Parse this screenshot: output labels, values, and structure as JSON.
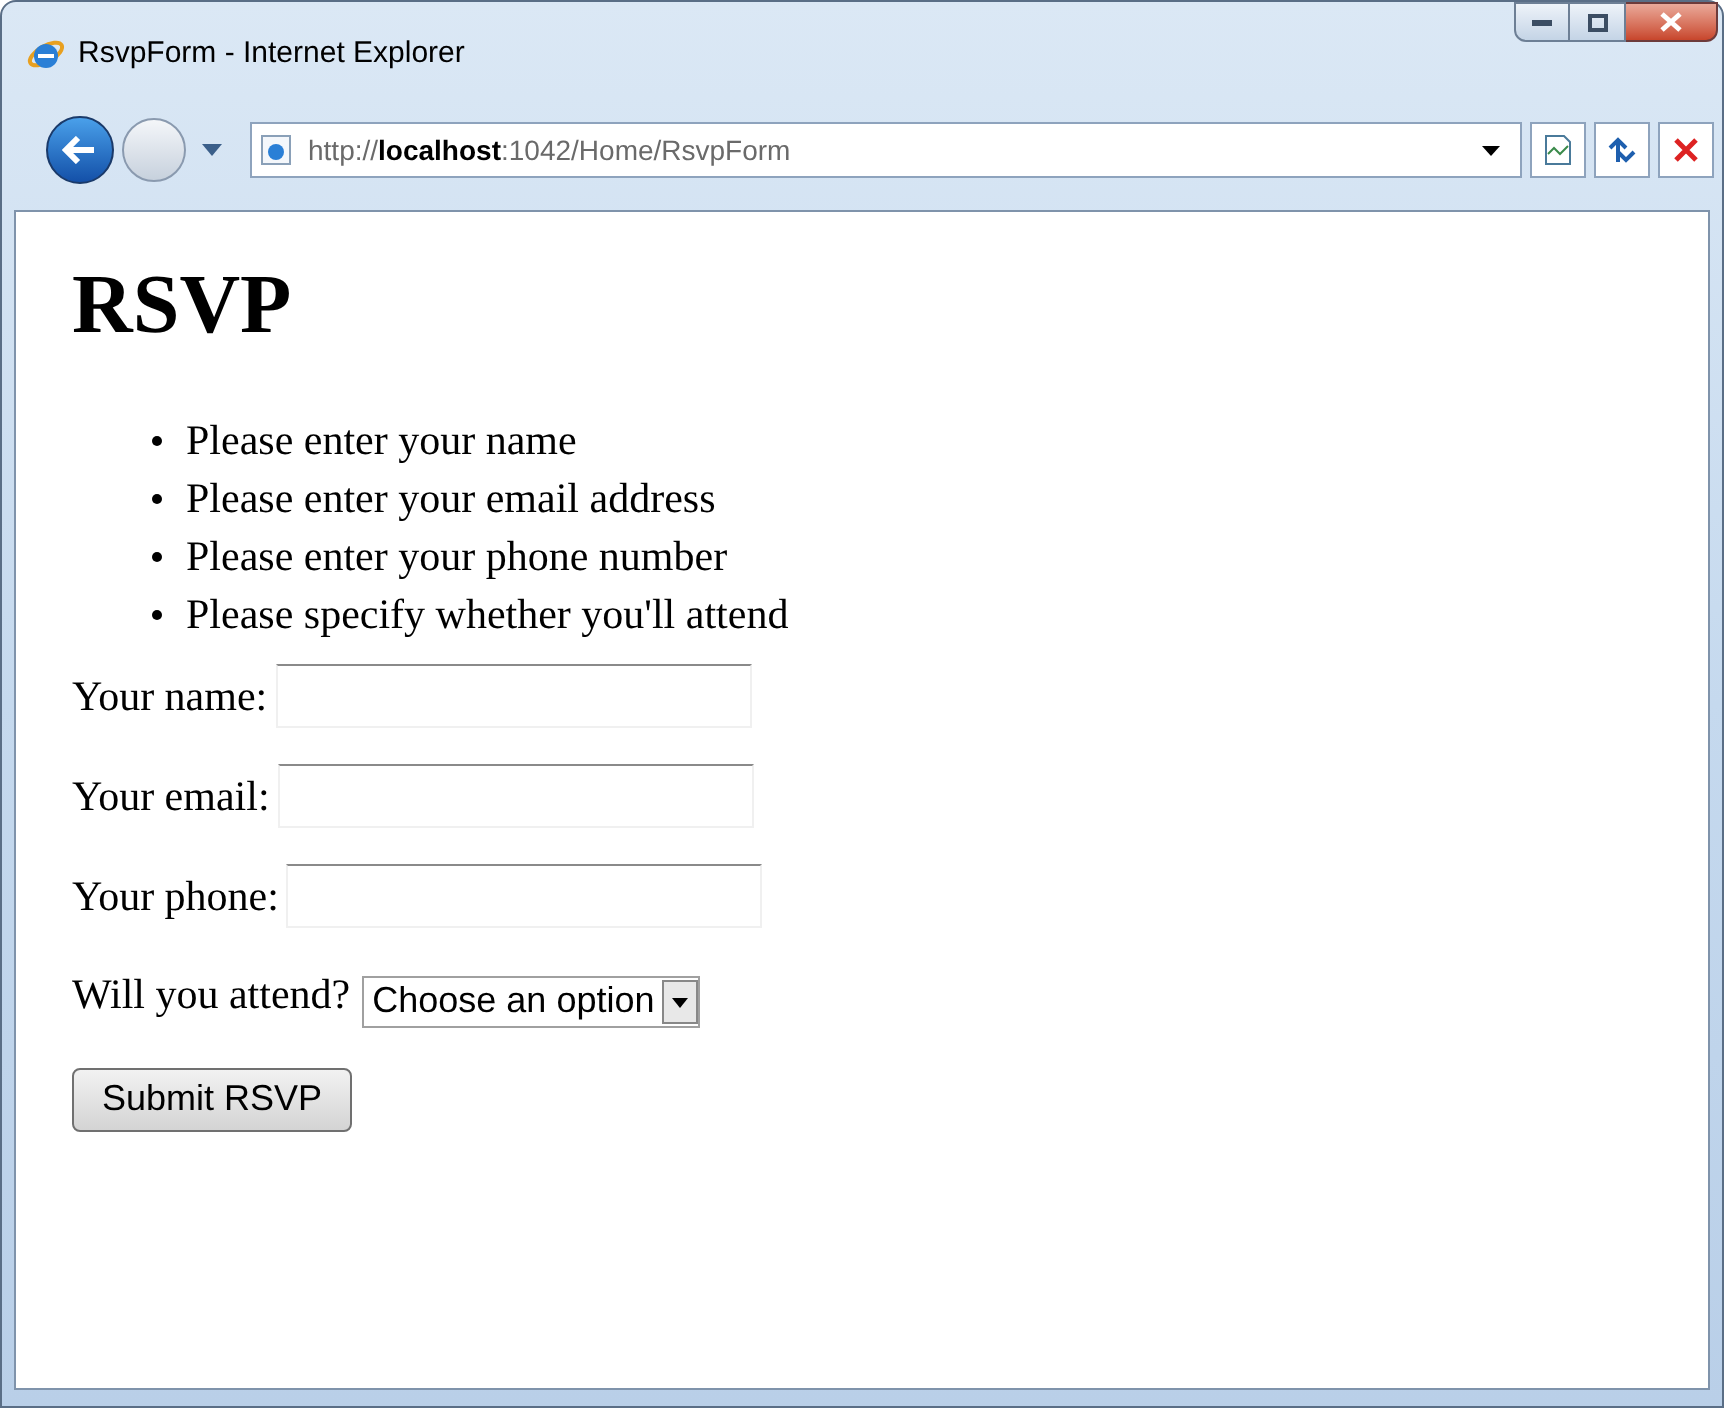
{
  "window": {
    "title": "RsvpForm - Internet Explorer"
  },
  "address_bar": {
    "url": "http://**localhost**:1042/Home/RsvpForm"
  },
  "page": {
    "heading": "RSVP",
    "errors": [
      "Please enter your name",
      "Please enter your email address",
      "Please enter your phone number",
      "Please specify whether you'll attend"
    ],
    "fields": [
      {
        "label": "Your name:",
        "kind": "text"
      },
      {
        "label": "Your email:",
        "kind": "text"
      },
      {
        "label": "Your phone:",
        "kind": "text"
      },
      {
        "label": "Will you attend?",
        "kind": "select",
        "value": "Choose an option"
      }
    ],
    "submit": "Submit RSVP"
  }
}
